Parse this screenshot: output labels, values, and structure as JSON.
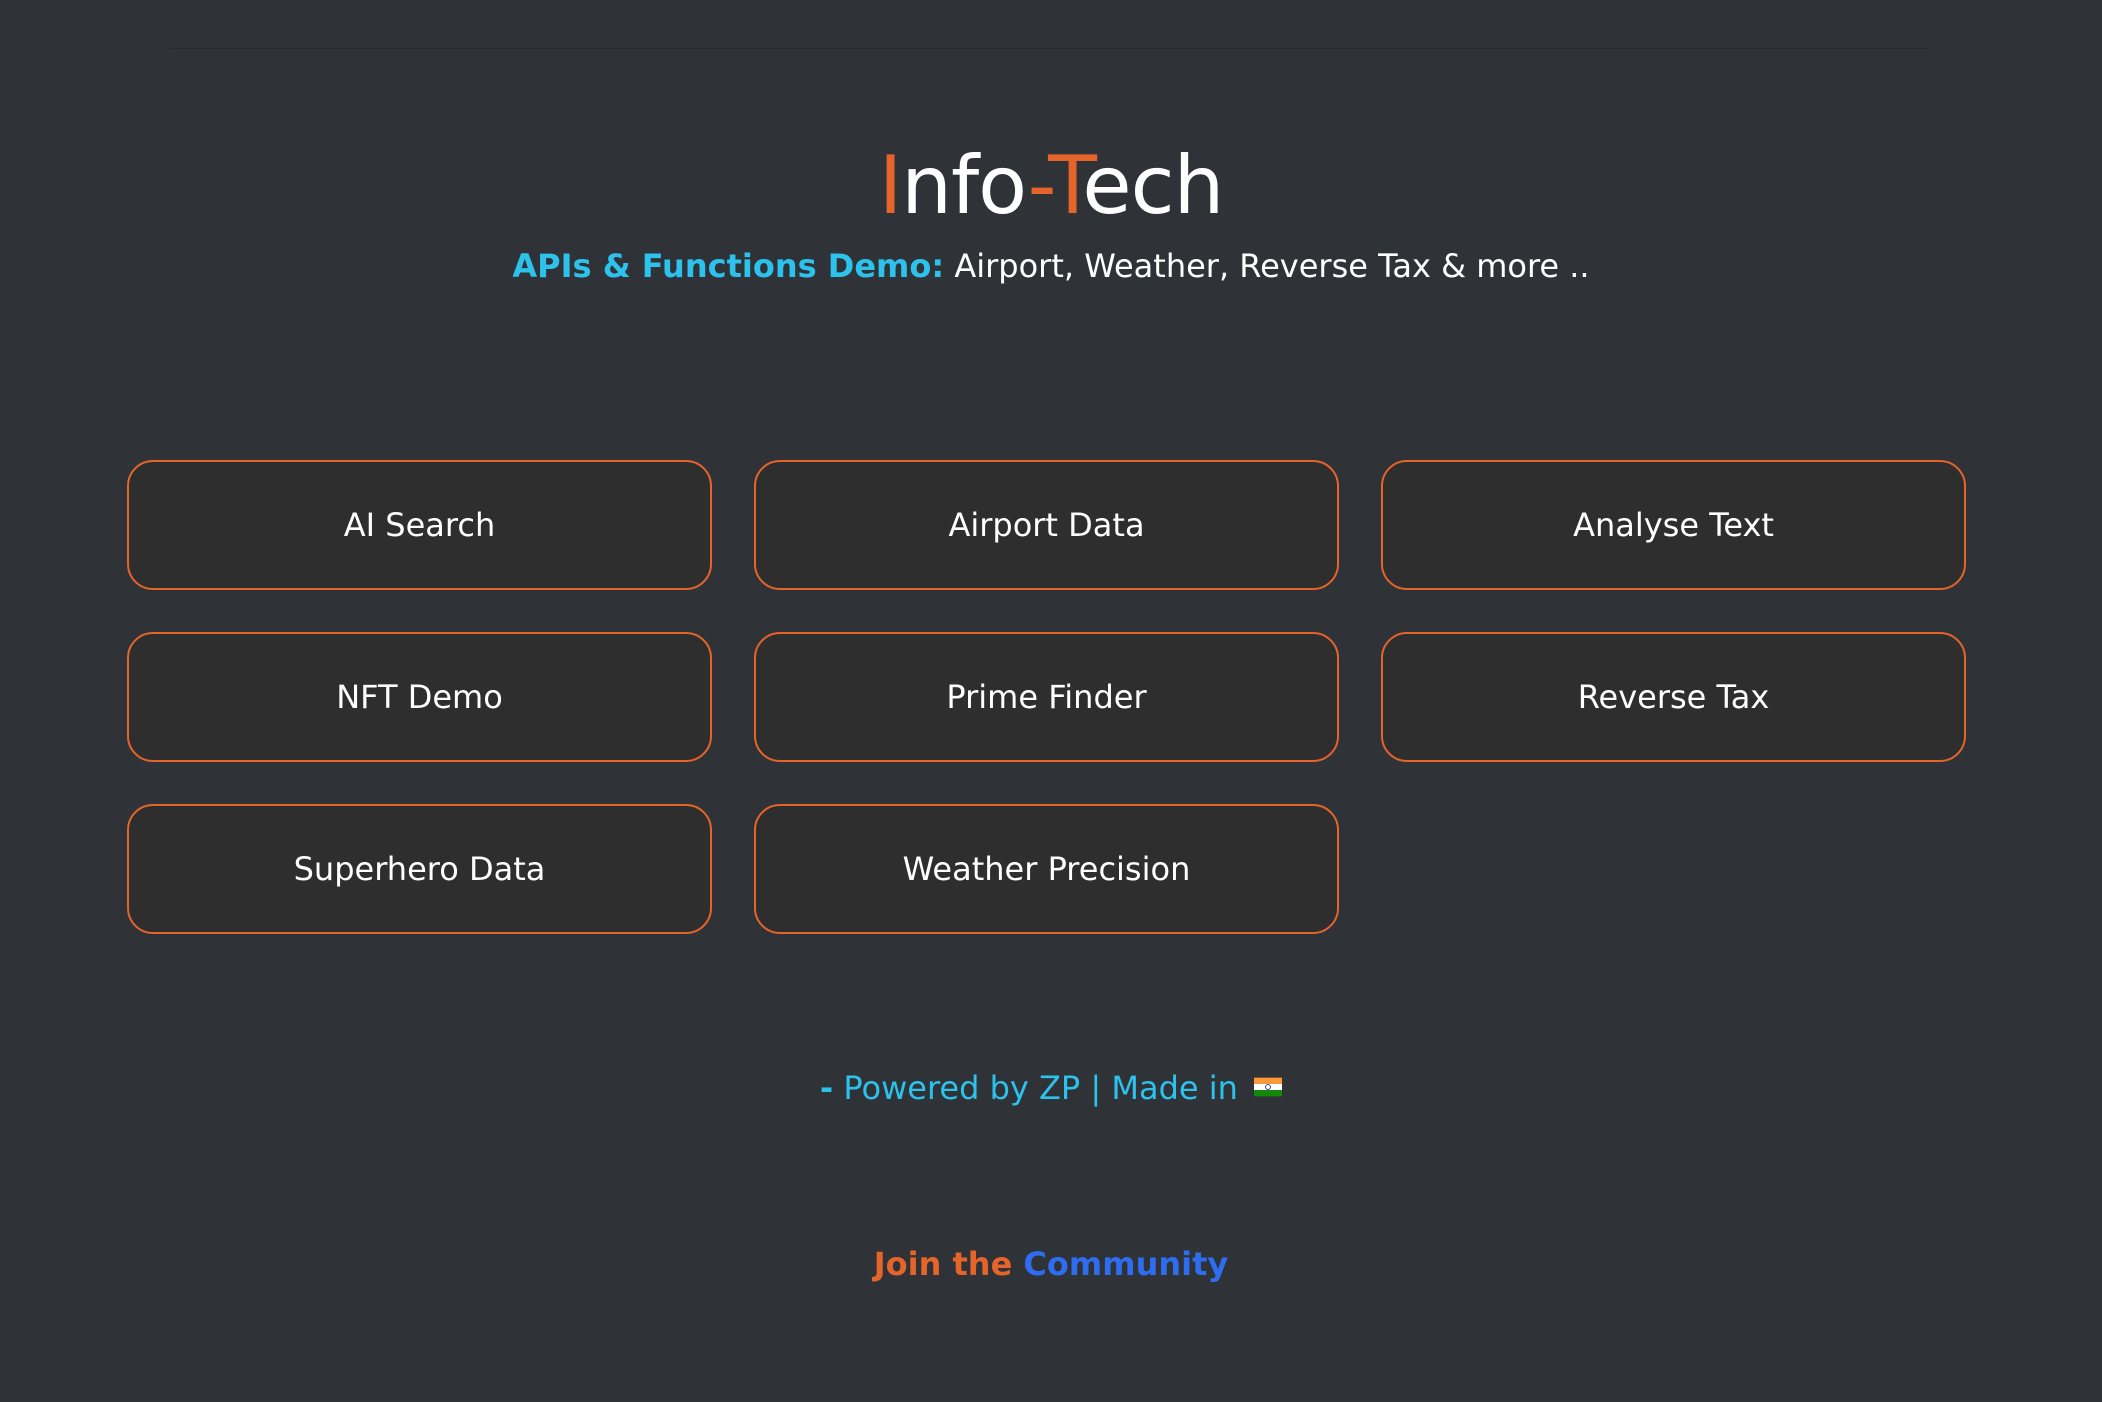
{
  "header": {
    "title_first_letter": "I",
    "title_part1": "nfo",
    "title_hyphen": "-",
    "title_second_letter": "T",
    "title_part2": "ech"
  },
  "subtitle": {
    "lead": "APIs & Functions Demo:",
    "text": " Airport, Weather, Reverse Tax & more .."
  },
  "buttons": [
    {
      "label": "AI Search"
    },
    {
      "label": "Airport Data"
    },
    {
      "label": "Analyse Text"
    },
    {
      "label": "NFT Demo"
    },
    {
      "label": "Prime Finder"
    },
    {
      "label": "Reverse Tax"
    },
    {
      "label": "Superhero Data"
    },
    {
      "label": "Weather Precision"
    }
  ],
  "footer": {
    "dash": "-",
    "text": " Powered by ZP | Made in ",
    "flag_icon": "india-flag-icon"
  },
  "community": {
    "join": "Join the ",
    "link": "Community"
  },
  "colors": {
    "background": "#2f3338",
    "accent": "#e4642a",
    "cyan": "#2cc2ec",
    "link_blue": "#2f6df0",
    "button_bg": "#2e2e2e"
  }
}
